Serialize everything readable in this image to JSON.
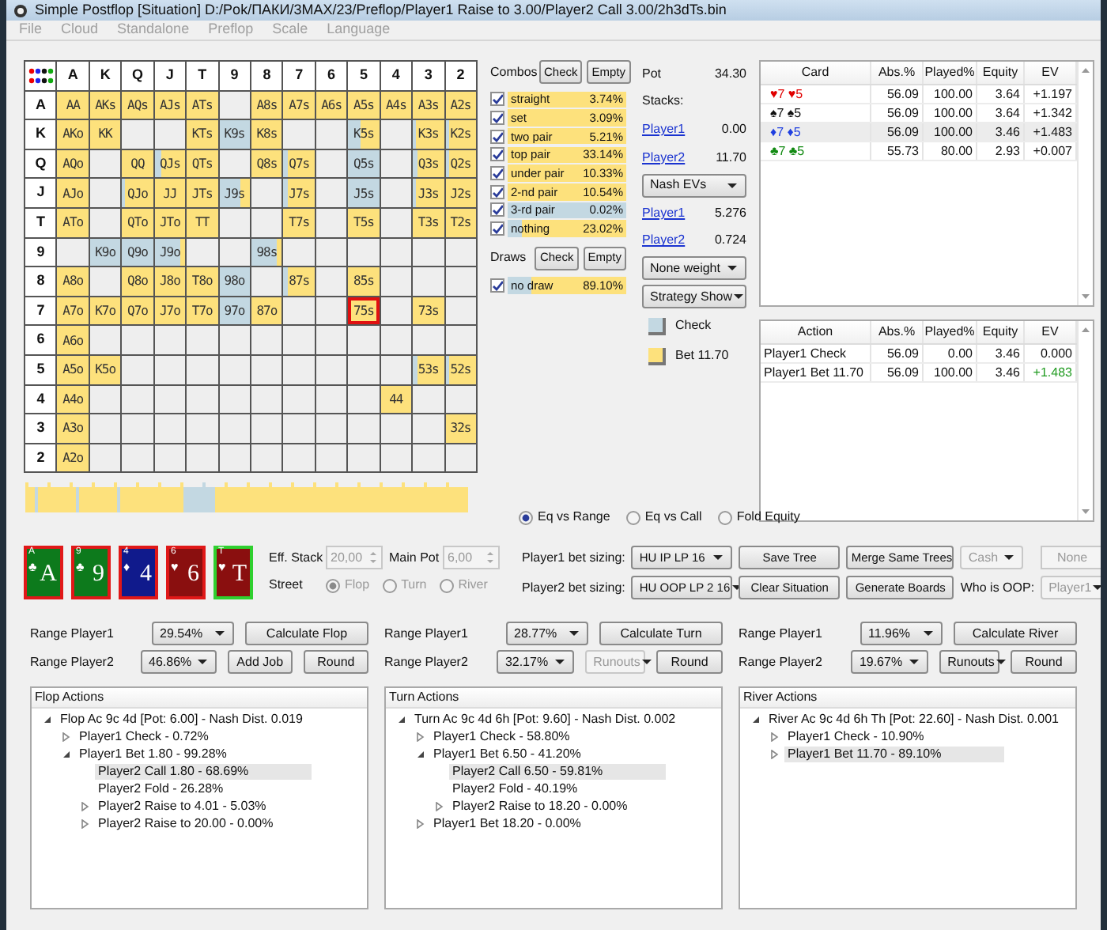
{
  "window": {
    "title": "Simple Postflop [Situation] D:/Pok/ПАКИ/3MAX/23/Preflop/Player1 Raise to 3.00/Player2 Call 3.00/2h3dTs.bin"
  },
  "menu": [
    {
      "label": "File"
    },
    {
      "label": "Cloud"
    },
    {
      "label": "Standalone"
    },
    {
      "label": "Preflop"
    },
    {
      "label": "Scale"
    },
    {
      "label": "Language"
    }
  ],
  "matrix": {
    "columns": [
      "A",
      "K",
      "Q",
      "J",
      "T",
      "9",
      "8",
      "7",
      "6",
      "5",
      "4",
      "3",
      "2"
    ],
    "rows": [
      {
        "label": "A",
        "cells": [
          {
            "text": "AA",
            "level": 1,
            "selected": false
          },
          {
            "text": "AKs",
            "level": 1,
            "selected": false
          },
          {
            "text": "AQs",
            "level": 1,
            "selected": false
          },
          {
            "text": "AJs",
            "level": 1,
            "selected": false
          },
          {
            "text": "ATs",
            "level": 1,
            "selected": false
          },
          {
            "selected": false
          },
          {
            "text": "A8s",
            "level": 1,
            "selected": false
          },
          {
            "text": "A7s",
            "level": 1,
            "selected": false
          },
          {
            "text": "A6s",
            "level": 1,
            "selected": false
          },
          {
            "text": "A5s",
            "level": 1,
            "selected": false
          },
          {
            "text": "A4s",
            "level": 1,
            "selected": false
          },
          {
            "text": "A3s",
            "level": 1,
            "selected": false
          },
          {
            "text": "A2s",
            "level": 1,
            "selected": false
          }
        ]
      },
      {
        "label": "K",
        "cells": [
          {
            "text": "AKo",
            "level": 1,
            "selected": false
          },
          {
            "text": "KK",
            "level": 1,
            "selected": false
          },
          {
            "selected": false
          },
          {
            "selected": false
          },
          {
            "text": "KTs",
            "level": 1,
            "selected": false
          },
          {
            "text": "K9s",
            "level": 0,
            "selected": false
          },
          {
            "text": "K8s",
            "level": 1,
            "selected": false
          },
          {
            "selected": false
          },
          {
            "selected": false
          },
          {
            "text": "K5s",
            "level": 0.6,
            "selected": false
          },
          {
            "selected": false
          },
          {
            "text": "K3s",
            "level": 0.9,
            "selected": false
          },
          {
            "text": "K2s",
            "level": 0.9,
            "selected": false
          }
        ]
      },
      {
        "label": "Q",
        "cells": [
          {
            "text": "AQo",
            "level": 1,
            "selected": false
          },
          {
            "selected": false
          },
          {
            "text": "QQ",
            "level": 1,
            "selected": false
          },
          {
            "text": "QJs",
            "level": 0.8,
            "selected": false
          },
          {
            "text": "QTs",
            "level": 1,
            "selected": false
          },
          {
            "selected": false
          },
          {
            "text": "Q8s",
            "level": 1,
            "selected": false
          },
          {
            "text": "Q7s",
            "level": 0.85,
            "selected": false
          },
          {
            "selected": false
          },
          {
            "text": "Q5s",
            "level": 0,
            "selected": false
          },
          {
            "selected": false
          },
          {
            "text": "Q3s",
            "level": 0.85,
            "selected": false
          },
          {
            "text": "Q2s",
            "level": 0.85,
            "selected": false
          }
        ]
      },
      {
        "label": "J",
        "cells": [
          {
            "text": "AJo",
            "level": 1,
            "selected": false
          },
          {
            "selected": false
          },
          {
            "text": "QJo",
            "level": 0.9,
            "selected": false
          },
          {
            "text": "JJ",
            "level": 1,
            "selected": false
          },
          {
            "text": "JTs",
            "level": 1,
            "selected": false
          },
          {
            "text": "J9s",
            "level": 0.3,
            "selected": false
          },
          {
            "selected": false
          },
          {
            "text": "J7s",
            "level": 0.85,
            "selected": false
          },
          {
            "selected": false
          },
          {
            "text": "J5s",
            "level": 0,
            "selected": false
          },
          {
            "selected": false
          },
          {
            "text": "J3s",
            "level": 0.9,
            "selected": false
          },
          {
            "text": "J2s",
            "level": 1,
            "selected": false
          }
        ]
      },
      {
        "label": "T",
        "cells": [
          {
            "text": "ATo",
            "level": 1,
            "selected": false
          },
          {
            "selected": false
          },
          {
            "text": "QTo",
            "level": 1,
            "selected": false
          },
          {
            "text": "JTo",
            "level": 1,
            "selected": false
          },
          {
            "text": "TT",
            "level": 1,
            "selected": false
          },
          {
            "selected": false
          },
          {
            "selected": false
          },
          {
            "text": "T7s",
            "level": 1,
            "selected": false
          },
          {
            "selected": false
          },
          {
            "text": "T5s",
            "level": 1,
            "selected": false
          },
          {
            "selected": false
          },
          {
            "text": "T3s",
            "level": 1,
            "selected": false
          },
          {
            "text": "T2s",
            "level": 1,
            "selected": false
          }
        ]
      },
      {
        "label": "9",
        "cells": [
          {
            "selected": false
          },
          {
            "text": "K9o",
            "level": 0,
            "selected": false
          },
          {
            "text": "Q9o",
            "level": 0,
            "selected": false
          },
          {
            "text": "J9o",
            "level": 0.15,
            "selected": false
          },
          {
            "selected": false
          },
          {
            "selected": false
          },
          {
            "text": "98s",
            "level": 0.2,
            "selected": false
          },
          {
            "selected": false
          },
          {
            "selected": false
          },
          {
            "selected": false
          },
          {
            "selected": false
          },
          {
            "selected": false
          },
          {
            "selected": false
          }
        ]
      },
      {
        "label": "8",
        "cells": [
          {
            "text": "A8o",
            "level": 1,
            "selected": false
          },
          {
            "selected": false
          },
          {
            "text": "Q8o",
            "level": 1,
            "selected": false
          },
          {
            "text": "J8o",
            "level": 1,
            "selected": false
          },
          {
            "text": "T8o",
            "level": 1,
            "selected": false
          },
          {
            "text": "98o",
            "level": 0,
            "selected": false
          },
          {
            "selected": false
          },
          {
            "text": "87s",
            "level": 0.85,
            "selected": false
          },
          {
            "selected": false
          },
          {
            "text": "85s",
            "level": 1,
            "selected": false
          },
          {
            "selected": false
          },
          {
            "selected": false
          },
          {
            "selected": false
          }
        ]
      },
      {
        "label": "7",
        "cells": [
          {
            "text": "A7o",
            "level": 1,
            "selected": false
          },
          {
            "text": "K7o",
            "level": 1,
            "selected": false
          },
          {
            "text": "Q7o",
            "level": 1,
            "selected": false
          },
          {
            "text": "J7o",
            "level": 1,
            "selected": false
          },
          {
            "text": "T7o",
            "level": 1,
            "selected": false
          },
          {
            "text": "97o",
            "level": 0,
            "selected": false
          },
          {
            "text": "87o",
            "level": 1,
            "selected": false
          },
          {
            "selected": false
          },
          {
            "selected": false
          },
          {
            "text": "75s",
            "level": 1,
            "selected": true
          },
          {
            "selected": false
          },
          {
            "text": "73s",
            "level": 1,
            "selected": false
          },
          {
            "selected": false
          }
        ]
      },
      {
        "label": "6",
        "cells": [
          {
            "text": "A6o",
            "level": 1,
            "selected": false
          },
          {
            "selected": false
          },
          {
            "selected": false
          },
          {
            "selected": false
          },
          {
            "selected": false
          },
          {
            "selected": false
          },
          {
            "selected": false
          },
          {
            "selected": false
          },
          {
            "selected": false
          },
          {
            "selected": false
          },
          {
            "selected": false
          },
          {
            "selected": false
          },
          {
            "selected": false
          }
        ]
      },
      {
        "label": "5",
        "cells": [
          {
            "text": "A5o",
            "level": 1,
            "selected": false
          },
          {
            "text": "K5o",
            "level": 1,
            "selected": false
          },
          {
            "selected": false
          },
          {
            "selected": false
          },
          {
            "selected": false
          },
          {
            "selected": false
          },
          {
            "selected": false
          },
          {
            "selected": false
          },
          {
            "selected": false
          },
          {
            "selected": false
          },
          {
            "selected": false
          },
          {
            "text": "53s",
            "level": 0.85,
            "selected": false
          },
          {
            "text": "52s",
            "level": 0.85,
            "selected": false
          }
        ]
      },
      {
        "label": "4",
        "cells": [
          {
            "text": "A4o",
            "level": 1,
            "selected": false
          },
          {
            "selected": false
          },
          {
            "selected": false
          },
          {
            "selected": false
          },
          {
            "selected": false
          },
          {
            "selected": false
          },
          {
            "selected": false
          },
          {
            "selected": false
          },
          {
            "selected": false
          },
          {
            "selected": false
          },
          {
            "text": "44",
            "level": 1,
            "selected": false
          },
          {
            "selected": false
          },
          {
            "selected": false
          }
        ]
      },
      {
        "label": "3",
        "cells": [
          {
            "text": "A3o",
            "level": 1,
            "selected": false
          },
          {
            "selected": false
          },
          {
            "selected": false
          },
          {
            "selected": false
          },
          {
            "selected": false
          },
          {
            "selected": false
          },
          {
            "selected": false
          },
          {
            "selected": false
          },
          {
            "selected": false
          },
          {
            "selected": false
          },
          {
            "selected": false
          },
          {
            "selected": false
          },
          {
            "text": "32s",
            "level": 1,
            "selected": false
          }
        ]
      },
      {
        "label": "2",
        "cells": [
          {
            "text": "A2o",
            "level": 1,
            "selected": false
          },
          {
            "selected": false
          },
          {
            "selected": false
          },
          {
            "selected": false
          },
          {
            "selected": false
          },
          {
            "selected": false
          },
          {
            "selected": false
          },
          {
            "selected": false
          },
          {
            "selected": false
          },
          {
            "selected": false
          },
          {
            "selected": false
          },
          {
            "selected": false
          },
          {
            "selected": false
          }
        ]
      }
    ]
  },
  "combos": {
    "title": "Combos",
    "buttons": [
      "Check",
      "Empty"
    ],
    "items": [
      {
        "label": "straight",
        "value": "3.74%",
        "checked": true,
        "level": 1
      },
      {
        "label": "set",
        "value": "3.09%",
        "checked": true,
        "level": 1
      },
      {
        "label": "two pair",
        "value": "5.21%",
        "checked": true,
        "level": 1
      },
      {
        "label": "top pair",
        "value": "33.14%",
        "checked": true,
        "level": 1
      },
      {
        "label": "under pair",
        "value": "10.33%",
        "checked": true,
        "level": 1
      },
      {
        "label": "2-nd pair",
        "value": "10.54%",
        "checked": true,
        "level": 1
      },
      {
        "label": "3-rd pair",
        "value": "0.02%",
        "checked": true,
        "level": 0
      },
      {
        "label": "nothing",
        "value": "23.02%",
        "checked": true,
        "level": 0.88
      }
    ]
  },
  "draws": {
    "title": "Draws",
    "buttons": [
      "Check",
      "Empty"
    ],
    "items": [
      {
        "label": "no draw",
        "value": "89.10%",
        "checked": true,
        "level": 0.8
      }
    ]
  },
  "summary": {
    "pot_label": "Pot",
    "pot": "34.30",
    "stacks_label": "Stacks:",
    "stacks": [
      {
        "player": "Player1",
        "value": "0.00"
      },
      {
        "player": "Player2",
        "value": "11.70"
      }
    ],
    "ev_select": "Nash EVs",
    "evs": [
      {
        "player": "Player1",
        "value": "5.276"
      },
      {
        "player": "Player2",
        "value": "0.724"
      }
    ],
    "weight_select": "None weight",
    "strategy_select": "Strategy Show",
    "legend": [
      {
        "label": "Check",
        "color": "#c3d8e2"
      },
      {
        "label": "Bet 11.70",
        "color": "#fde17c"
      }
    ]
  },
  "card_table": {
    "columns": [
      "Card",
      "Abs.%",
      "Played%",
      "Equity",
      "EV"
    ],
    "rows": [
      {
        "card": "♥7 ♥5",
        "color": "#e00000",
        "abs": "56.09",
        "played": "100.00",
        "equity": "3.64",
        "ev": "+1.197",
        "selected": false
      },
      {
        "card": "♠7 ♠5",
        "color": "#111111",
        "abs": "56.09",
        "played": "100.00",
        "equity": "3.64",
        "ev": "+1.342",
        "selected": false
      },
      {
        "card": "♦7 ♦5",
        "color": "#1f3fe0",
        "abs": "56.09",
        "played": "100.00",
        "equity": "3.46",
        "ev": "+1.483",
        "selected": true
      },
      {
        "card": "♣7 ♣5",
        "color": "#128a12",
        "abs": "55.73",
        "played": "80.00",
        "equity": "2.93",
        "ev": "+0.007",
        "selected": false
      }
    ]
  },
  "action_table": {
    "columns": [
      "Action",
      "Abs.%",
      "Played%",
      "Equity",
      "EV"
    ],
    "rows": [
      {
        "action": "Player1 Check",
        "abs": "56.09",
        "played": "0.00",
        "equity": "3.46",
        "ev": "0.000",
        "color": "#111111"
      },
      {
        "action": "Player1 Bet 11.70",
        "abs": "56.09",
        "played": "100.00",
        "equity": "3.46",
        "ev": "+1.483",
        "color": "#1f9a1f"
      }
    ]
  },
  "equity_mode": [
    {
      "label": "Eq vs Range",
      "selected": true
    },
    {
      "label": "Eq vs Call",
      "selected": false
    },
    {
      "label": "Fold Equity",
      "selected": false
    }
  ],
  "board": [
    {
      "corner": "A",
      "suit": "♣",
      "rank": "A",
      "color": "#0d7a1c",
      "selected": false
    },
    {
      "corner": "9",
      "suit": "♣",
      "rank": "9",
      "color": "#0d7a1c",
      "selected": false
    },
    {
      "corner": "4",
      "suit": "♦",
      "rank": "4",
      "color": "#101a8c",
      "selected": false
    },
    {
      "corner": "6",
      "suit": "♥",
      "rank": "6",
      "color": "#8a0f0f",
      "selected": false
    },
    {
      "corner": "T",
      "suit": "♥",
      "rank": "T",
      "color": "#8a0f0f",
      "selected": true
    }
  ],
  "settings": {
    "eff_stack": {
      "label": "Eff. Stack",
      "value": "20,00",
      "disabled": true
    },
    "main_pot": {
      "label": "Main Pot",
      "value": "6,00",
      "disabled": true
    },
    "street": {
      "label": "Street",
      "disabled": true,
      "options": [
        {
          "label": "Flop",
          "selected": true
        },
        {
          "label": "Turn",
          "selected": false
        },
        {
          "label": "River",
          "selected": false
        }
      ]
    },
    "bet_sizing": [
      {
        "label": "Player1 bet sizing:",
        "value": "HU IP LP 16"
      },
      {
        "label": "Player2 bet sizing:",
        "value": "HU OOP LP 2 16"
      }
    ],
    "buttons": [
      [
        "Save Tree",
        "Merge Same Trees"
      ],
      [
        "Clear Situation",
        "Generate Boards"
      ]
    ],
    "game_select": {
      "value": "Cash",
      "disabled": true
    },
    "none_field": {
      "value": "None",
      "disabled": true
    },
    "oop": {
      "label": "Who is OOP:",
      "value": "Player1",
      "disabled": true
    }
  },
  "ranges": [
    {
      "rows": [
        {
          "label": "Range Player1",
          "value": "29.54%",
          "controls": [
            {
              "kind": "button",
              "label": "Calculate Flop",
              "disabled": false
            }
          ]
        },
        {
          "label": "Range Player2",
          "value": "46.86%",
          "controls": [
            {
              "kind": "button",
              "label": "Add Job",
              "disabled": false
            },
            {
              "kind": "button",
              "label": "Round",
              "disabled": false
            }
          ]
        }
      ]
    },
    {
      "rows": [
        {
          "label": "Range Player1",
          "value": "28.77%",
          "controls": [
            {
              "kind": "button",
              "label": "Calculate Turn",
              "disabled": false
            }
          ]
        },
        {
          "label": "Range Player2",
          "value": "32.17%",
          "controls": [
            {
              "kind": "select",
              "label": "Runouts",
              "disabled": true
            },
            {
              "kind": "button",
              "label": "Round",
              "disabled": false
            }
          ]
        }
      ]
    },
    {
      "rows": [
        {
          "label": "Range Player1",
          "value": "11.96%",
          "controls": [
            {
              "kind": "button",
              "label": "Calculate River",
              "disabled": false
            }
          ]
        },
        {
          "label": "Range Player2",
          "value": "19.67%",
          "controls": [
            {
              "kind": "select",
              "label": "Runouts",
              "disabled": false
            },
            {
              "kind": "button",
              "label": "Round",
              "disabled": false
            }
          ]
        }
      ]
    }
  ],
  "trees": [
    {
      "title": "Flop Actions",
      "nodes": [
        {
          "label": "Flop Ac 9c 4d [Pot: 6.00] - Nash Dist. 0.019",
          "expanded": true,
          "selected": false,
          "children": [
            {
              "label": "Player1 Check - 0.72%",
              "expanded": false,
              "selected": false
            },
            {
              "label": "Player1 Bet 1.80 - 99.28%",
              "expanded": true,
              "selected": false,
              "children": [
                {
                  "label": "Player2 Call 1.80 - 68.69%",
                  "selected": true
                },
                {
                  "label": "Player2 Fold - 26.28%",
                  "selected": false
                },
                {
                  "label": "Player2 Raise to 4.01 - 5.03%",
                  "expanded": false,
                  "selected": false
                },
                {
                  "label": "Player2 Raise to 20.00 - 0.00%",
                  "expanded": false,
                  "selected": false
                }
              ]
            }
          ]
        }
      ]
    },
    {
      "title": "Turn Actions",
      "nodes": [
        {
          "label": "Turn Ac 9c 4d 6h [Pot: 9.60] - Nash Dist. 0.002",
          "expanded": true,
          "selected": false,
          "children": [
            {
              "label": "Player1 Check - 58.80%",
              "expanded": false,
              "selected": false
            },
            {
              "label": "Player1 Bet 6.50 - 41.20%",
              "expanded": true,
              "selected": false,
              "children": [
                {
                  "label": "Player2 Call 6.50 - 59.81%",
                  "selected": true
                },
                {
                  "label": "Player2 Fold - 40.19%",
                  "selected": false
                },
                {
                  "label": "Player2 Raise to 18.20 - 0.00%",
                  "expanded": false,
                  "selected": false
                }
              ]
            },
            {
              "label": "Player1 Bet 18.20 - 0.00%",
              "expanded": false,
              "selected": false
            }
          ]
        }
      ]
    },
    {
      "title": "River Actions",
      "nodes": [
        {
          "label": "River Ac 9c 4d 6h Th [Pot: 22.60] - Nash Dist. 0.001",
          "expanded": true,
          "selected": false,
          "children": [
            {
              "label": "Player1 Check - 10.90%",
              "expanded": false,
              "selected": false
            },
            {
              "label": "Player1 Bet 11.70 - 89.10%",
              "expanded": false,
              "selected": true
            }
          ]
        }
      ]
    }
  ]
}
